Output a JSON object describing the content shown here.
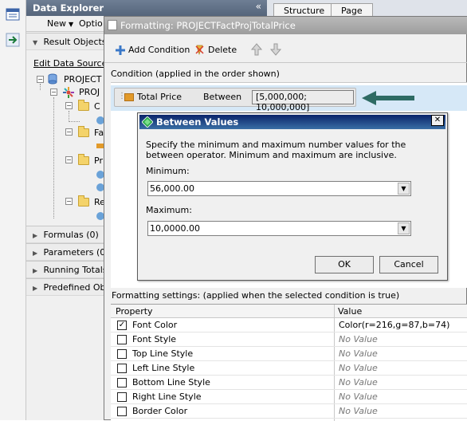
{
  "explorer": {
    "title": "Data Explorer",
    "collapse_glyph": "«",
    "toolbar": {
      "new_label": "New",
      "options_label": "Optio"
    },
    "result_objects_label": "Result Objects",
    "edit_data_sources": "Edit Data Sources",
    "tree": {
      "project_label": "PROJECT",
      "proj_label": "PROJ",
      "folder_labels": [
        "C",
        "Fa",
        "Pr",
        "Re"
      ]
    },
    "sections": [
      "Formulas (0)",
      "Parameters (0)",
      "Running Totals",
      "Predefined Ob"
    ]
  },
  "tabs": [
    "Structure",
    "Page"
  ],
  "formatting": {
    "title": "Formatting: PROJECTFactProjTotalPrice",
    "add_condition": "Add Condition",
    "delete": "Delete",
    "condition_header": "Condition (applied in the order shown)",
    "condition": {
      "field": "Total Price",
      "operator": "Between",
      "values": "[5,000,000; 10,000,000]"
    },
    "settings_label": "Formatting settings: (applied when the selected condition is true)",
    "columns": {
      "property": "Property",
      "value": "Value"
    },
    "rows": [
      {
        "property": "Font Color",
        "value": "Color(r=216,g=87,b=74)",
        "checked": true
      },
      {
        "property": "Font Style",
        "value": "No Value",
        "checked": false
      },
      {
        "property": "Top Line Style",
        "value": "No Value",
        "checked": false
      },
      {
        "property": "Left Line Style",
        "value": "No Value",
        "checked": false
      },
      {
        "property": "Bottom Line Style",
        "value": "No Value",
        "checked": false
      },
      {
        "property": "Right Line Style",
        "value": "No Value",
        "checked": false
      },
      {
        "property": "Border Color",
        "value": "No Value",
        "checked": false
      }
    ]
  },
  "between": {
    "title": "Between Values",
    "close_glyph": "✕",
    "description": "Specify the minimum and maximum number values for the between operator. Minimum and maximum are inclusive.",
    "minimum_label": "Minimum:",
    "minimum_value": "56,000.00",
    "maximum_label": "Maximum:",
    "maximum_value": "10,0000.00",
    "ok": "OK",
    "cancel": "Cancel"
  },
  "colors": {
    "arrow": "#2e6b64",
    "selection": "#d6e8f7",
    "title_bar": "#0a246a"
  }
}
